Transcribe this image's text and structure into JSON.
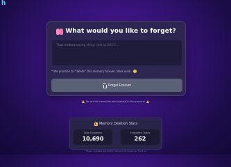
{
  "brand": {
    "text": "h"
  },
  "card": {
    "title": "What would you like to forget?",
    "title_icon": "brain-icon",
    "input_placeholder": "That embarrassing thing I did in 2017...",
    "input_value": "",
    "promise_text": "* We promise to \"delete\" this memory forever. Wink wink.",
    "promise_icon": "smile-icon",
    "forget_button_label": "Forget Forever",
    "forget_button_icon": "trash-icon"
  },
  "disclaimer": {
    "text": "No actual memories are harmed in this process",
    "icon": "warning-icon"
  },
  "stats": {
    "title": "Memory Deletion Stats",
    "icon": "chart-icon",
    "total_label": "Total Forgotten",
    "total_value": "10,690",
    "today_label": "Forgotten Today",
    "today_value": "262"
  },
  "footnote": "* These numbers are totally real and not made up. Trust us.",
  "colors": {
    "background_center": "#5a1f9a",
    "background_edge": "#130838",
    "card": "#2d284e",
    "button": "#5a6176",
    "brand": "#4fd1ff"
  }
}
